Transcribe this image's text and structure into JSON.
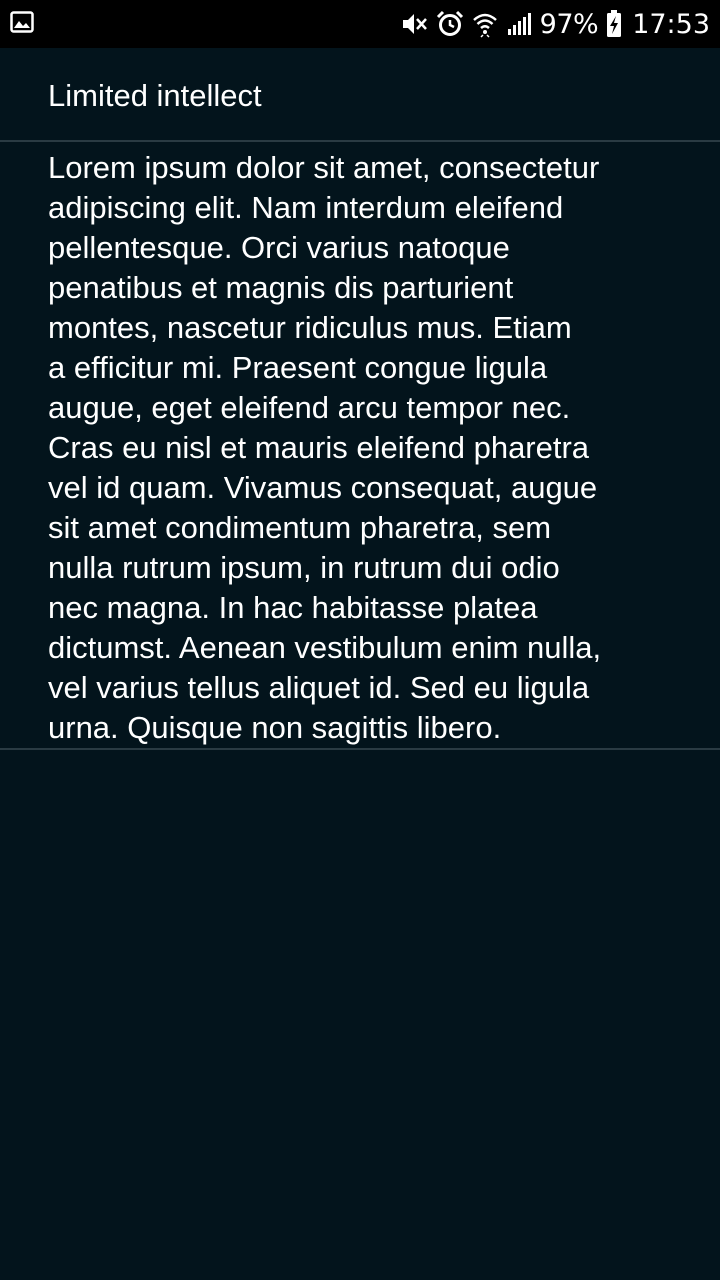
{
  "status_bar": {
    "left_icons": [
      "image-notification-icon"
    ],
    "right_icons": [
      "mute-icon",
      "alarm-icon",
      "wifi-icon",
      "signal-icon",
      "battery-charging-icon"
    ],
    "battery_percent": "97%",
    "time": "17:53"
  },
  "header": {
    "title": "Limited intellect"
  },
  "content": {
    "text": "Lorem ipsum dolor sit amet, consectetur\nadipiscing elit. Nam interdum eleifend\npellentesque. Orci varius natoque\npenatibus et magnis dis parturient\nmontes, nascetur ridiculus mus. Etiam\na efficitur mi. Praesent congue ligula\naugue, eget eleifend arcu tempor nec.\nCras eu nisl et mauris eleifend pharetra\nvel id quam. Vivamus consequat, augue\nsit amet condimentum pharetra, sem\nnulla rutrum ipsum, in rutrum dui odio\nnec magna. In hac habitasse platea\ndictumst. Aenean vestibulum enim nulla,\nvel varius tellus aliquet id. Sed eu ligula\nurna. Quisque non sagittis libero."
  },
  "colors": {
    "background": "#03141c",
    "status_bar": "#000000",
    "divider": "#2a3b43",
    "text": "#ffffff"
  }
}
